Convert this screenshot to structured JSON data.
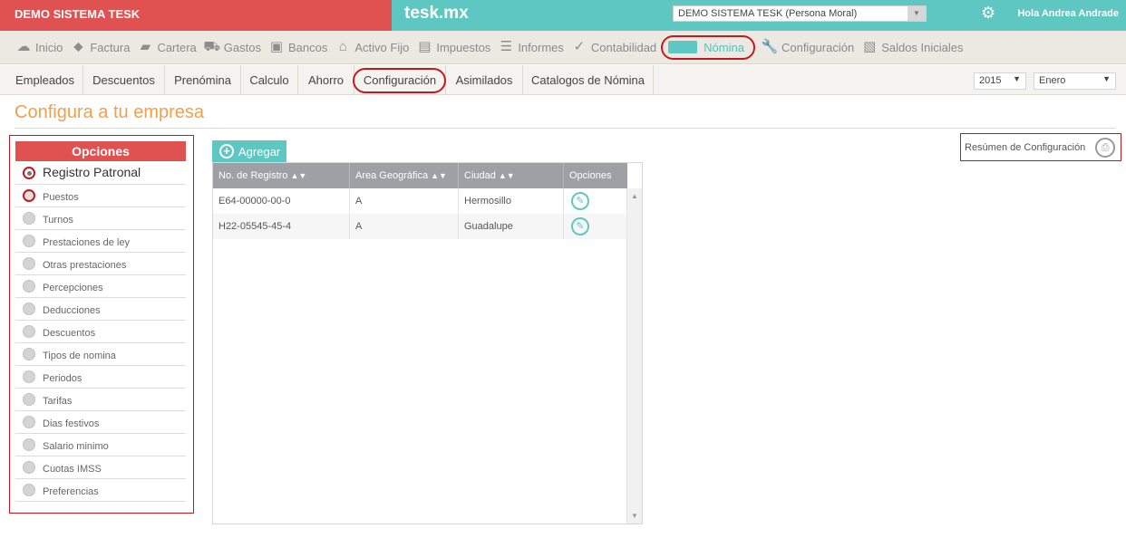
{
  "topbar": {
    "company_label": "DEMO SISTEMA TESK",
    "brand": "tesk.mx",
    "company_select_value": "DEMO SISTEMA TESK (Persona Moral)",
    "gear_icon": "gear-icon",
    "user_greeting": "Hola Andrea Andrade"
  },
  "main_nav": {
    "items": [
      {
        "label": "Inicio",
        "icon": "cloud-icon"
      },
      {
        "label": "Factura",
        "icon": "tag-icon"
      },
      {
        "label": "Cartera",
        "icon": "wallet-icon"
      },
      {
        "label": "Gastos",
        "icon": "cart-icon"
      },
      {
        "label": "Bancos",
        "icon": "safe-icon"
      },
      {
        "label": "Activo Fijo",
        "icon": "house-icon"
      },
      {
        "label": "Impuestos",
        "icon": "briefcase-icon"
      },
      {
        "label": "Informes",
        "icon": "report-icon"
      },
      {
        "label": "Contabilidad",
        "icon": "chart-icon"
      },
      {
        "label": "Nómina",
        "icon": "card-icon"
      },
      {
        "label": "Configuración",
        "icon": "wrench-icon"
      },
      {
        "label": "Saldos Iniciales",
        "icon": "document-check-icon"
      }
    ],
    "active": "Nómina"
  },
  "sub_nav": {
    "items": [
      "Empleados",
      "Descuentos",
      "Prenómina",
      "Calculo",
      "Ahorro",
      "Configuración",
      "Asimilados",
      "Catalogos de Nómina"
    ],
    "active": "Configuración",
    "year_value": "2015",
    "month_value": "Enero"
  },
  "page": {
    "title": "Configura a tu empresa"
  },
  "options_panel": {
    "header": "Opciones",
    "items": [
      {
        "label": "Registro Patronal",
        "selected": true
      },
      {
        "label": "Puestos",
        "selected": false
      },
      {
        "label": "Turnos",
        "selected": false
      },
      {
        "label": "Prestaciones de ley",
        "selected": false
      },
      {
        "label": "Otras prestaciones",
        "selected": false
      },
      {
        "label": "Percepciones",
        "selected": false
      },
      {
        "label": "Deducciones",
        "selected": false
      },
      {
        "label": "Descuentos",
        "selected": false
      },
      {
        "label": "Tipos de nomina",
        "selected": false
      },
      {
        "label": "Periodos",
        "selected": false
      },
      {
        "label": "Tarifas",
        "selected": false
      },
      {
        "label": "Dias festivos",
        "selected": false
      },
      {
        "label": "Salario minimo",
        "selected": false
      },
      {
        "label": "Cuotas IMSS",
        "selected": false
      },
      {
        "label": "Preferencias",
        "selected": false
      }
    ]
  },
  "actions": {
    "add_label": "Agregar",
    "summary_label": "Resúmen de Configuración"
  },
  "table": {
    "columns": [
      "No. de Registro",
      "Area Geográfica",
      "Ciudad",
      "Opciones"
    ],
    "rows": [
      {
        "registro": "E64-00000-00-0",
        "area": "A",
        "ciudad": "Hermosillo"
      },
      {
        "registro": "H22-05545-45-4",
        "area": "A",
        "ciudad": "Guadalupe"
      }
    ]
  },
  "colors": {
    "brand_red": "#e05252",
    "brand_teal": "#5fc7c2",
    "title_orange": "#f0a04b",
    "highlight_ring": "#c0191f"
  }
}
